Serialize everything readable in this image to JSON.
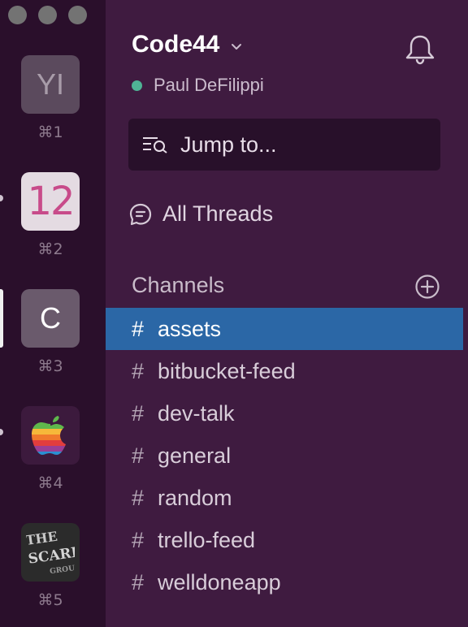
{
  "workspaces": [
    {
      "tile_text": "YI",
      "shortcut": "⌘1"
    },
    {
      "tile_text": "12",
      "shortcut": "⌘2"
    },
    {
      "tile_text": "C",
      "shortcut": "⌘3"
    },
    {
      "tile_text": "",
      "icon": "apple-logo",
      "shortcut": "⌘4"
    },
    {
      "tile_text": "THE SCARPETTA GROUP",
      "shortcut": "⌘5"
    }
  ],
  "sidebar": {
    "team_name": "Code44",
    "user_name": "Paul DeFilippi",
    "presence_color": "#4fb395",
    "jump_placeholder": "Jump to...",
    "all_threads_label": "All Threads",
    "channels_header": "Channels",
    "channels": [
      {
        "hash": "#",
        "name": "assets",
        "active": true
      },
      {
        "hash": "#",
        "name": "bitbucket-feed"
      },
      {
        "hash": "#",
        "name": "dev-talk"
      },
      {
        "hash": "#",
        "name": "general"
      },
      {
        "hash": "#",
        "name": "random"
      },
      {
        "hash": "#",
        "name": "trello-feed"
      },
      {
        "hash": "#",
        "name": "welldoneapp"
      }
    ]
  },
  "colors": {
    "sidebar_bg": "#3f1b40",
    "rail_bg": "#2a0f2b",
    "active_channel": "#2b67a6"
  }
}
